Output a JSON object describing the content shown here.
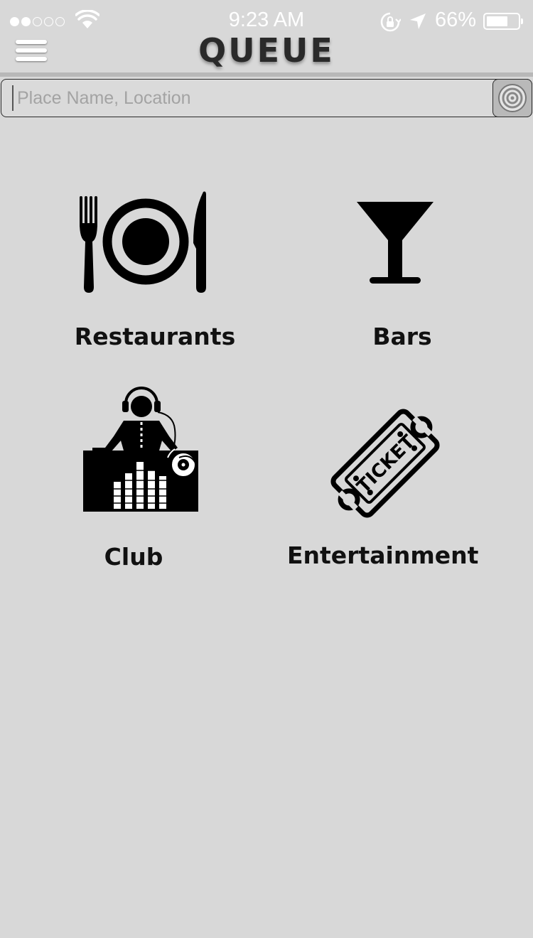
{
  "status_bar": {
    "time": "9:23 AM",
    "battery_percent": "66%",
    "signal_strength": 2,
    "signal_max": 5,
    "battery_level": 0.66,
    "icons": [
      "signal-dots-icon",
      "wifi-icon",
      "rotation-lock-icon",
      "location-arrow-icon",
      "battery-icon"
    ]
  },
  "header": {
    "menu_icon": "hamburger-menu-icon",
    "app_title": "QUEUE"
  },
  "search": {
    "placeholder": "Place Name, Location",
    "value": "",
    "button_icon": "target-locate-icon"
  },
  "categories": [
    {
      "label": "Restaurants",
      "icon": "fork-plate-knife-icon"
    },
    {
      "label": "Bars",
      "icon": "cocktail-glass-icon"
    },
    {
      "label": "Club",
      "icon": "dj-mixer-icon"
    },
    {
      "label": "Entertainment",
      "icon": "ticket-icon"
    }
  ],
  "colors": {
    "background": "#d8d8d8",
    "status_text": "#ffffff",
    "logo": "#2a2a2a",
    "icon": "#000000",
    "locate_button": "#b9b9b9"
  }
}
